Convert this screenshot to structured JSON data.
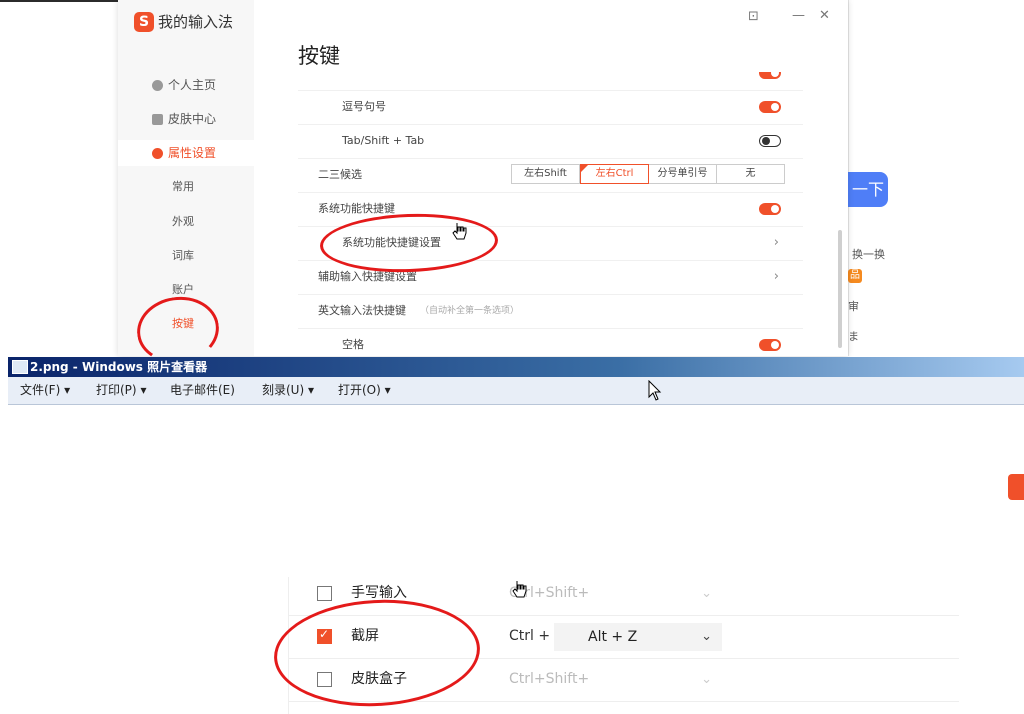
{
  "background_window": {
    "button_label": "一下",
    "line1": "换一换",
    "badge": "品",
    "line2": "审",
    "line3": "ま"
  },
  "settings": {
    "app_title": "我的输入法",
    "logo_char": "S",
    "window_controls": {
      "feedback": "⊡",
      "minimize": "—",
      "close": "✕"
    },
    "sidebar": {
      "items": [
        {
          "label": "个人主页"
        },
        {
          "label": "皮肤中心"
        },
        {
          "label": "属性设置"
        }
      ],
      "sub_items": [
        {
          "label": "常用"
        },
        {
          "label": "外观"
        },
        {
          "label": "词库"
        },
        {
          "label": "账户"
        },
        {
          "label": "按键"
        }
      ]
    },
    "page_title": "按键",
    "rows": [
      {
        "label": "逗号句号",
        "toggle": "on"
      },
      {
        "label": "Tab/Shift + Tab",
        "toggle": "off"
      },
      {
        "label": "二三候选"
      },
      {
        "label": "系统功能快捷键",
        "toggle": "on"
      },
      {
        "label": "系统功能快捷键设置"
      },
      {
        "label": "辅助输入快捷键设置"
      },
      {
        "label": "英文输入法快捷键",
        "hint": "（自动补全第一条选项）"
      },
      {
        "label": "空格",
        "toggle": "on"
      }
    ],
    "candidate_options": [
      "左右Shift",
      "左右Ctrl",
      "分号单引号",
      "无"
    ],
    "candidate_selected": "左右Ctrl",
    "chevron": "›"
  },
  "viewer": {
    "title": "2.png - Windows 照片查看器",
    "menus": [
      {
        "label": "文件(F)",
        "arrow": "▾"
      },
      {
        "label": "打印(P)",
        "arrow": "▾"
      },
      {
        "label": "电子邮件(E)"
      },
      {
        "label": "刻录(U)",
        "arrow": "▾"
      },
      {
        "label": "打开(O)",
        "arrow": "▾"
      }
    ],
    "image_rows": [
      {
        "label": "手写输入",
        "checked": false,
        "prefix": "Ctrl+Shift+",
        "chevron": "⌄"
      },
      {
        "label": "截屏",
        "checked": true,
        "prefix": "Ctrl +",
        "value": "Alt + Z",
        "chevron": "⌄"
      },
      {
        "label": "皮肤盒子",
        "checked": false,
        "prefix": "Ctrl+Shift+",
        "chevron": "⌄"
      }
    ]
  },
  "colors": {
    "accent": "#f0502a",
    "annotation": "#e41a1a",
    "titlebar": "#0a246a"
  }
}
